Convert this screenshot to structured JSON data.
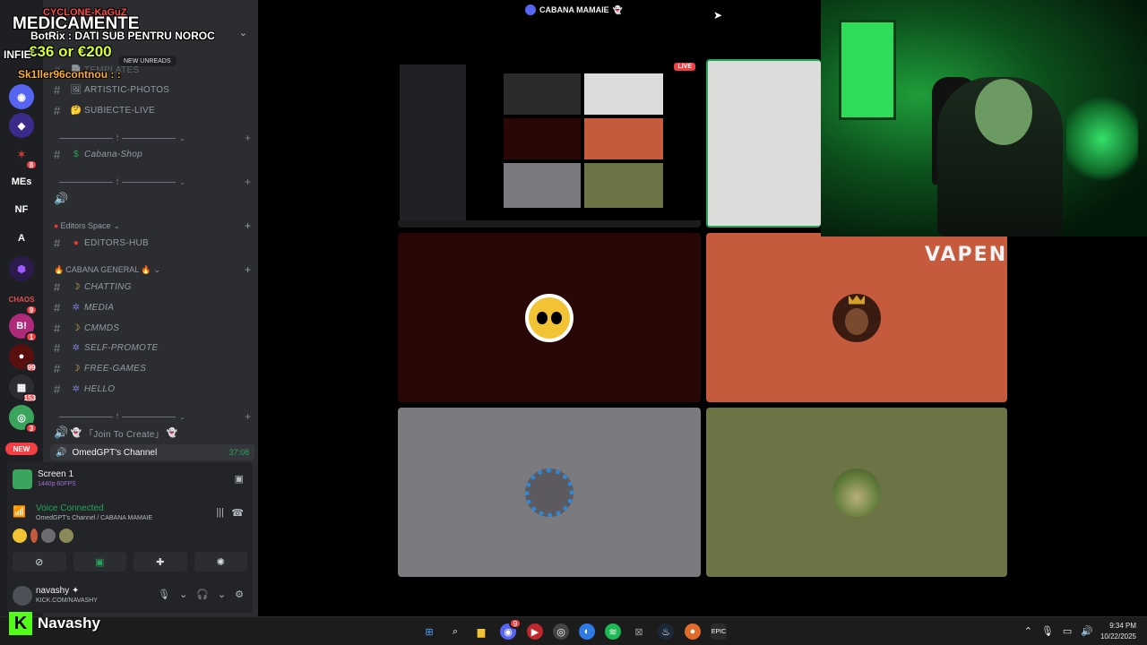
{
  "chat_overlay": {
    "lines": [
      {
        "text": "CYCLONE-KaGuZ",
        "color": "#ff4a4a"
      },
      {
        "text": "MEDICAMENTE",
        "color": "#ffffff"
      },
      {
        "text": "BotRix : DATI SUB PENTRU NOROC",
        "color": "#ffffff"
      },
      {
        "text": "€36 or €200",
        "color": "#d7ff2c"
      },
      {
        "text": "INFIE",
        "color": "#ffffff"
      },
      {
        "text": "Sk1ller96contnou : :",
        "color": "#ffb020"
      }
    ]
  },
  "server_rail": {
    "items": [
      {
        "label": "MEs"
      },
      {
        "label": "NF"
      },
      {
        "label": "A"
      }
    ],
    "badges": [
      "8",
      "9",
      "1",
      "99",
      "153",
      "3"
    ],
    "new_pill": "NEW"
  },
  "sidebar": {
    "new_unreads": "NEW UNREADS",
    "top_items": [
      "TEMPLATES"
    ],
    "channels_a": [
      {
        "emoji": "🖼",
        "name": "ARTISTIC-PHOTOS"
      },
      {
        "emoji": "🤔",
        "name": "SUBIECTE-LIVE"
      }
    ],
    "shop": {
      "emoji": "$",
      "name": "Cabana-Shop"
    },
    "editors_cat": "Editors Space",
    "editors_hub": "EDITORS-HUB",
    "general_cat": "CABANA GENERAL",
    "general_channels": [
      {
        "emoji": "☽",
        "name": "CHATTING"
      },
      {
        "emoji": "✲",
        "name": "MEDIA"
      },
      {
        "emoji": "☽",
        "name": "CMMDS"
      },
      {
        "emoji": "✲",
        "name": "SELF-PROMOTE"
      },
      {
        "emoji": "☽",
        "name": "FREE-GAMES"
      },
      {
        "emoji": "✲",
        "name": "HELLO"
      }
    ],
    "join_to_create": "「Join To Create」",
    "voice_channel": {
      "name": "OmedGPT's Channel",
      "time": "37:08"
    }
  },
  "panel": {
    "screen_title": "Screen 1",
    "screen_sub": "1440p 60FPS",
    "voice_status": "Voice Connected",
    "voice_sub": "OmedGPT's Channel / CABANA MAMAIE",
    "username": "navashy ✦",
    "user_sub": "KICK.COM/NAVASHY"
  },
  "main": {
    "title": "CABANA MAMAIE",
    "live_badge": "LIVE"
  },
  "tiles": [
    {
      "name": "tile-stream-preview",
      "bg": "#000000"
    },
    {
      "name": "tile-blank",
      "bg": "#dcdddb"
    },
    {
      "name": "tile-owl",
      "bg": "#2a0707",
      "avatar": "#f2c335"
    },
    {
      "name": "tile-king",
      "bg": "#c65a3d",
      "avatar": "#3a1b12"
    },
    {
      "name": "tile-skulls",
      "bg": "#7a7a7f",
      "avatar": "#2d88d8"
    },
    {
      "name": "tile-field",
      "bg": "#6c7446",
      "avatar": "#8a8a5a"
    }
  ],
  "branding": {
    "vapen": "VAPEN",
    "kick_name": "Navashy"
  },
  "taskbar": {
    "clock_time": "9:34 PM",
    "clock_date": "10/22/2025",
    "discord_badge": "9"
  }
}
